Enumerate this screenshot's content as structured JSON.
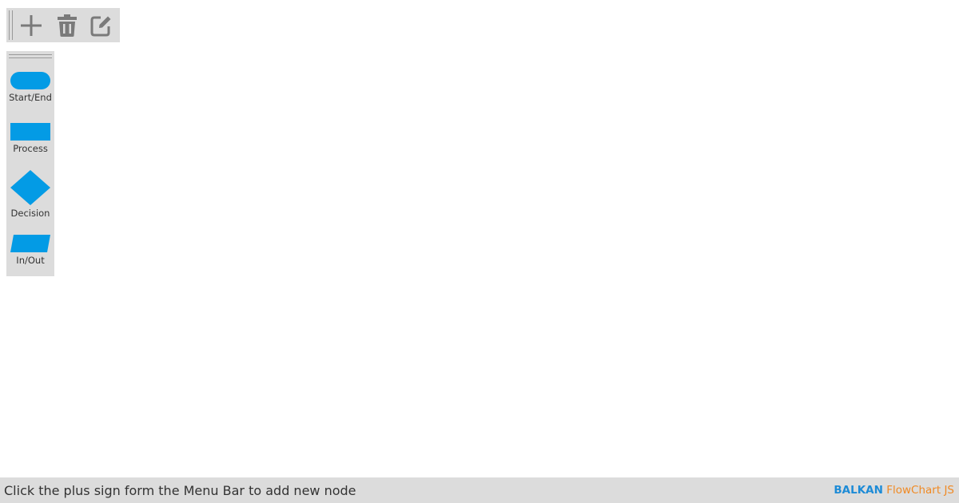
{
  "menu_bar": {
    "buttons": [
      {
        "icon": "plus-icon"
      },
      {
        "icon": "trash-icon"
      },
      {
        "icon": "edit-icon"
      }
    ],
    "icon_color": "#7a7a7a"
  },
  "shape_bar": {
    "shape_color": "#039be5",
    "items": [
      {
        "label": "Start/End",
        "icon": "start-end-shape-icon"
      },
      {
        "label": "Process",
        "icon": "process-shape-icon"
      },
      {
        "label": "Decision",
        "icon": "decision-shape-icon"
      },
      {
        "label": "In/Out",
        "icon": "in-out-shape-icon"
      }
    ]
  },
  "status_bar": {
    "message": "Click the plus sign form the Menu Bar to add new node",
    "brand_name": "BALKAN",
    "brand_product": "FlowChart JS",
    "brand_name_color": "#1d8bd6",
    "brand_product_color": "#f08a24"
  }
}
